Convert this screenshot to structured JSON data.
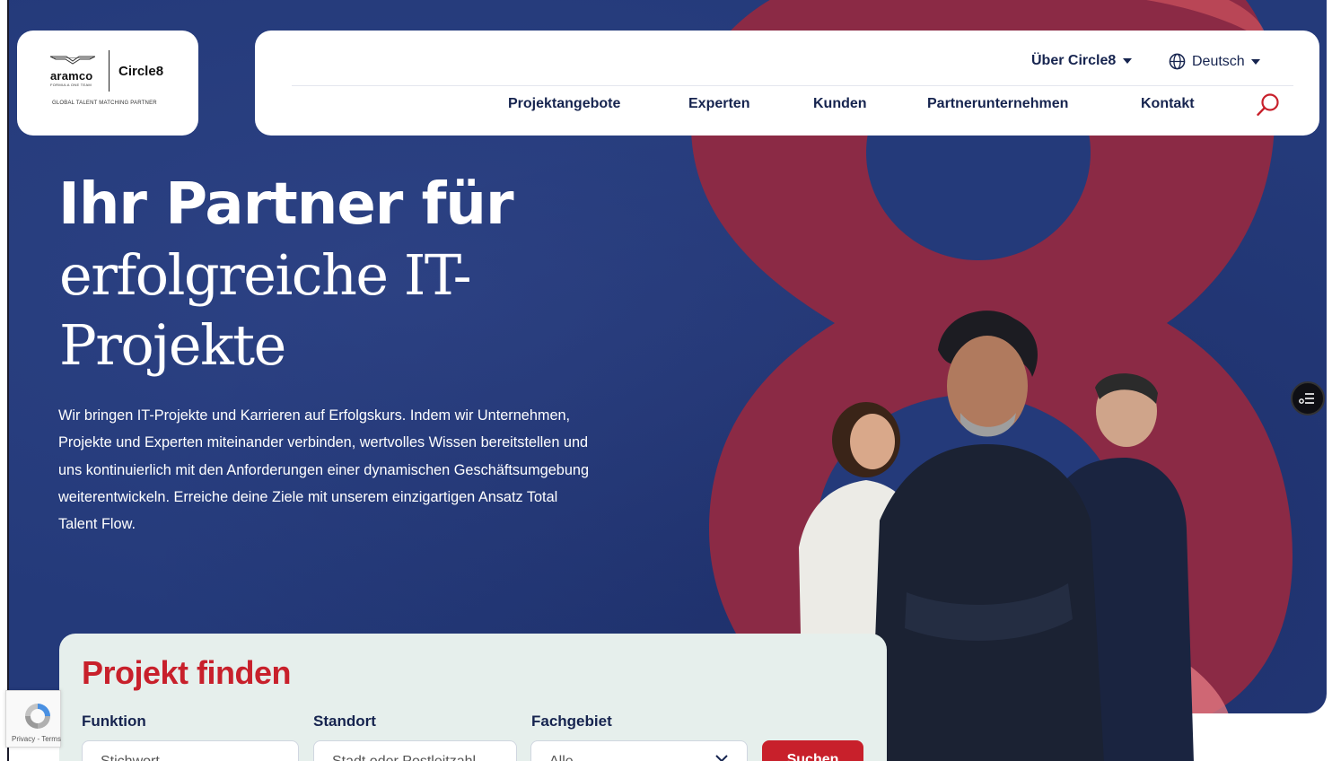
{
  "brand": {
    "sponsor_logo_text": "aramco",
    "sponsor_sub_text": "FORMULA ONE TEAM",
    "company_name": "Circle8",
    "partner_tagline": "GLOBAL TALENT MATCHING PARTNER"
  },
  "header": {
    "about_label": "Über Circle8",
    "language_label": "Deutsch",
    "nav": {
      "projects": "Projektangebote",
      "experts": "Experten",
      "clients": "Kunden",
      "partners": "Partnerunternehmen",
      "contact": "Kontakt"
    }
  },
  "hero": {
    "title_bold": "Ihr Partner für",
    "title_light": "erfolgreiche IT-Projekte",
    "intro": "Wir bringen IT-Projekte und Karrieren auf Erfolgskurs. Indem wir Unternehmen, Projekte und Experten miteinander verbinden, wertvolles Wissen bereitstellen und uns kontinuierlich mit den Anforderungen einer dynamischen Geschäftsumgebung weiterentwickeln. Erreiche deine Ziele mit unserem einzigartigen Ansatz Total Talent Flow."
  },
  "project_search": {
    "title": "Projekt finden",
    "function_label": "Funktion",
    "function_placeholder": "Stichwort",
    "location_label": "Standort",
    "location_placeholder": "Stadt oder Postleitzahl",
    "field_label": "Fachgebiet",
    "field_value": "Alle",
    "submit_label": "Suchen"
  },
  "recaptcha": {
    "text": "Privacy - Terms"
  },
  "colors": {
    "hero_blue": "#243a7a",
    "accent_red": "#c8202b",
    "eight_red": "#8b2a45",
    "navy_text": "#16244f",
    "panel_mint": "#e6efec"
  },
  "icons": [
    "globe-icon",
    "chevron-down-icon",
    "search-icon",
    "menu-widget-icon",
    "recaptcha-icon"
  ]
}
